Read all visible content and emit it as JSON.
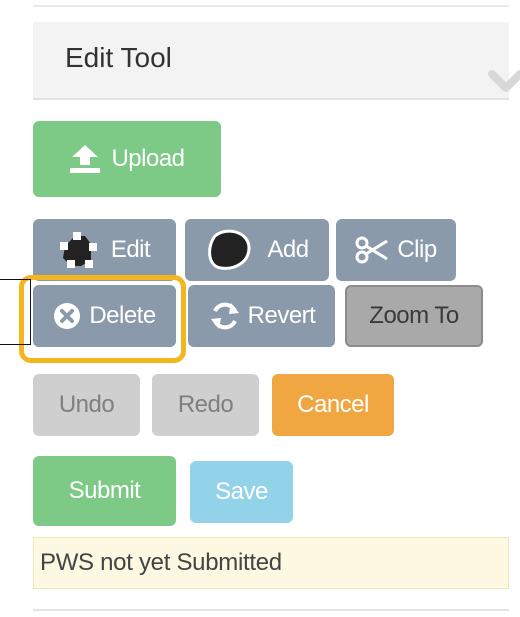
{
  "panel": {
    "title": "Edit Tool",
    "collapse_icon": "chevron-down-icon"
  },
  "buttons": {
    "upload": {
      "label": "Upload",
      "icon": "upload-icon"
    },
    "edit": {
      "label": "Edit",
      "icon": "edit-shape-icon"
    },
    "add": {
      "label": "Add",
      "icon": "add-shape-icon"
    },
    "clip": {
      "label": "Clip",
      "icon": "scissors-icon"
    },
    "delete": {
      "label": "Delete",
      "icon": "delete-circle-icon"
    },
    "revert": {
      "label": "Revert",
      "icon": "refresh-icon"
    },
    "zoom_to": {
      "label": "Zoom To"
    },
    "undo": {
      "label": "Undo"
    },
    "redo": {
      "label": "Redo"
    },
    "cancel": {
      "label": "Cancel"
    },
    "submit": {
      "label": "Submit"
    },
    "save": {
      "label": "Save"
    }
  },
  "status": {
    "text": "PWS not yet Submitted"
  },
  "colors": {
    "green": "#7dca86",
    "slate": "#8b9aaa",
    "orange": "#f0a741",
    "blue": "#93d3ea",
    "highlight": "#f3b61f",
    "status_bg": "#fcf8e1"
  }
}
